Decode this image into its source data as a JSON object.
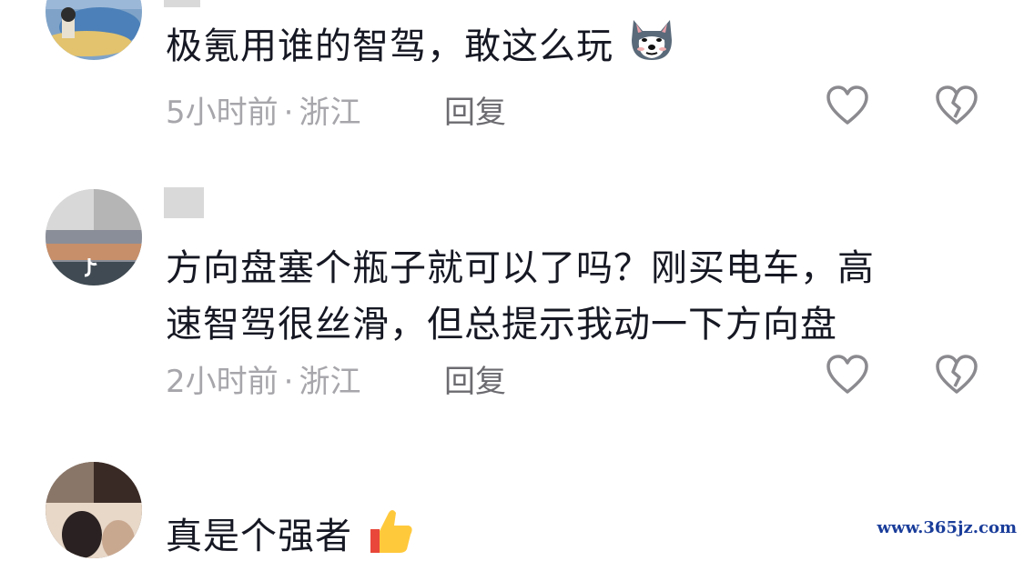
{
  "comments": [
    {
      "text": "极氪用谁的智驾，敢这么玩",
      "emoji": "husky-dog-emoji",
      "time": "5小时前",
      "location": "浙江",
      "reply_label": "回复",
      "like_icon": "heart-icon",
      "dislike_icon": "broken-heart-icon"
    },
    {
      "text_line1": "方向盘塞个瓶子就可以了吗？刚买电车，高",
      "text_line2": "速智驾很丝滑，但总提示我动一下方向盘",
      "time": "2小时前",
      "location": "浙江",
      "reply_label": "回复",
      "like_icon": "heart-icon",
      "dislike_icon": "broken-heart-icon"
    },
    {
      "text": "真是个强者",
      "emoji": "thumbs-up-emoji"
    }
  ],
  "meta_separator": "·",
  "watermark": "www.365jz.com",
  "colors": {
    "primary_text": "#161823",
    "secondary_text": "#a6a6ab",
    "reply_text": "#6b6b70",
    "icon_stroke": "#8a8a8f"
  }
}
